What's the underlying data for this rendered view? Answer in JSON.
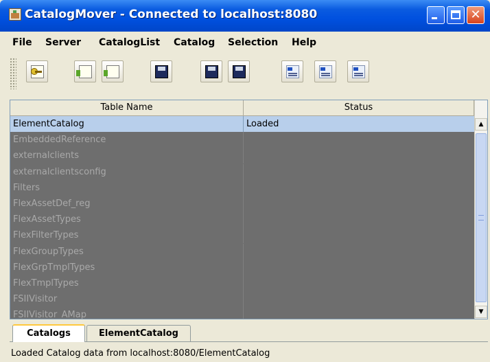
{
  "window": {
    "title": "CatalogMover - Connected to localhost:8080"
  },
  "menu": {
    "items": [
      "File",
      "Server",
      "CatalogList",
      "Catalog",
      "Selection",
      "Help"
    ]
  },
  "toolbar": {
    "buttons": [
      "connect-key-icon",
      "card-grid-icon",
      "card-grid-alt-icon",
      "disk-save-icon",
      "disk-export-icon",
      "disk-import-az-icon",
      "list-ab-icon",
      "list-select-icon",
      "list-grid-icon"
    ]
  },
  "table": {
    "columns": [
      "Table Name",
      "Status"
    ],
    "rows": [
      {
        "name": "ElementCatalog",
        "status": "Loaded"
      },
      {
        "name": "EmbeddedReference",
        "status": ""
      },
      {
        "name": "externalclients",
        "status": ""
      },
      {
        "name": "externalclientsconfig",
        "status": ""
      },
      {
        "name": "Filters",
        "status": ""
      },
      {
        "name": "FlexAssetDef_reg",
        "status": ""
      },
      {
        "name": "FlexAssetTypes",
        "status": ""
      },
      {
        "name": "FlexFilterTypes",
        "status": ""
      },
      {
        "name": "FlexGroupTypes",
        "status": ""
      },
      {
        "name": "FlexGrpTmplTypes",
        "status": ""
      },
      {
        "name": "FlexTmplTypes",
        "status": ""
      },
      {
        "name": "FSIIVisitor",
        "status": ""
      },
      {
        "name": "FSIIVisitor_AMap",
        "status": ""
      }
    ]
  },
  "tabs": [
    "Catalogs",
    "ElementCatalog"
  ],
  "status": {
    "text": "Loaded Catalog data from localhost:8080/ElementCatalog"
  },
  "colors": {
    "titlebar": "#0050DF",
    "selected_row": "#B8CFEB",
    "table_background": "#6E6E6E"
  }
}
